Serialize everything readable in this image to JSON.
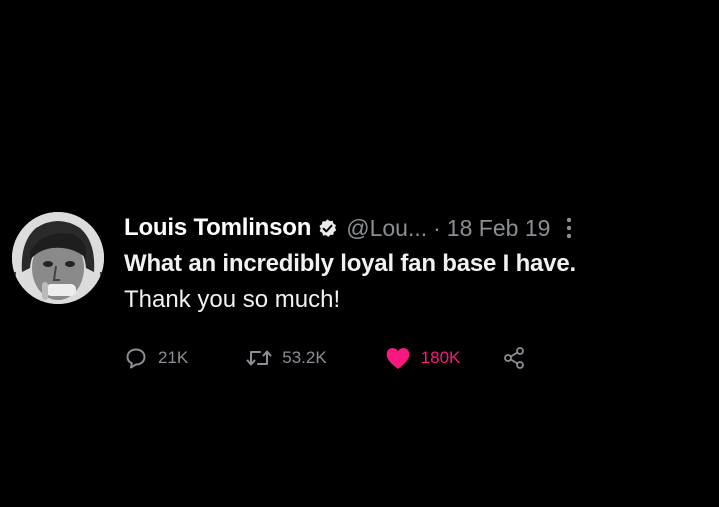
{
  "tweet": {
    "author_name": "Louis Tomlinson",
    "handle": "@Lou...",
    "separator": "·",
    "date": "18 Feb 19",
    "text_line1": "What an incredibly loyal fan base I have.",
    "text_line2": "Thank you so much!",
    "verified_icon": "verified-badge-icon",
    "more_icon": "vertical-dots-icon"
  },
  "actions": {
    "reply_count": "21K",
    "retweet_count": "53.2K",
    "like_count": "180K",
    "liked": true
  },
  "colors": {
    "background": "#000000",
    "name": "#ffffff",
    "muted": "#8b8f94",
    "like": "#f91880"
  }
}
